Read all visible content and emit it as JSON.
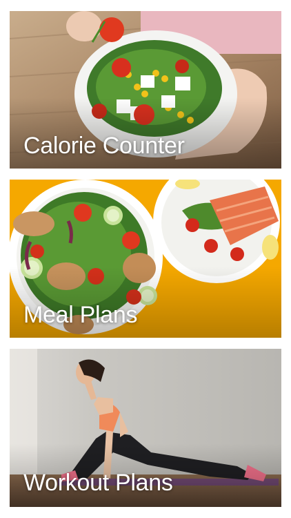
{
  "cards": [
    {
      "label": "Calorie Counter",
      "image": "salad-bowl-photo"
    },
    {
      "label": "Meal Plans",
      "image": "salad-and-salmon-plates-photo"
    },
    {
      "label": "Workout Plans",
      "image": "stretching-woman-photo"
    }
  ],
  "colors": {
    "background": "#ffffff",
    "meal_accent": "#f5a800",
    "label_text": "#ffffff"
  }
}
